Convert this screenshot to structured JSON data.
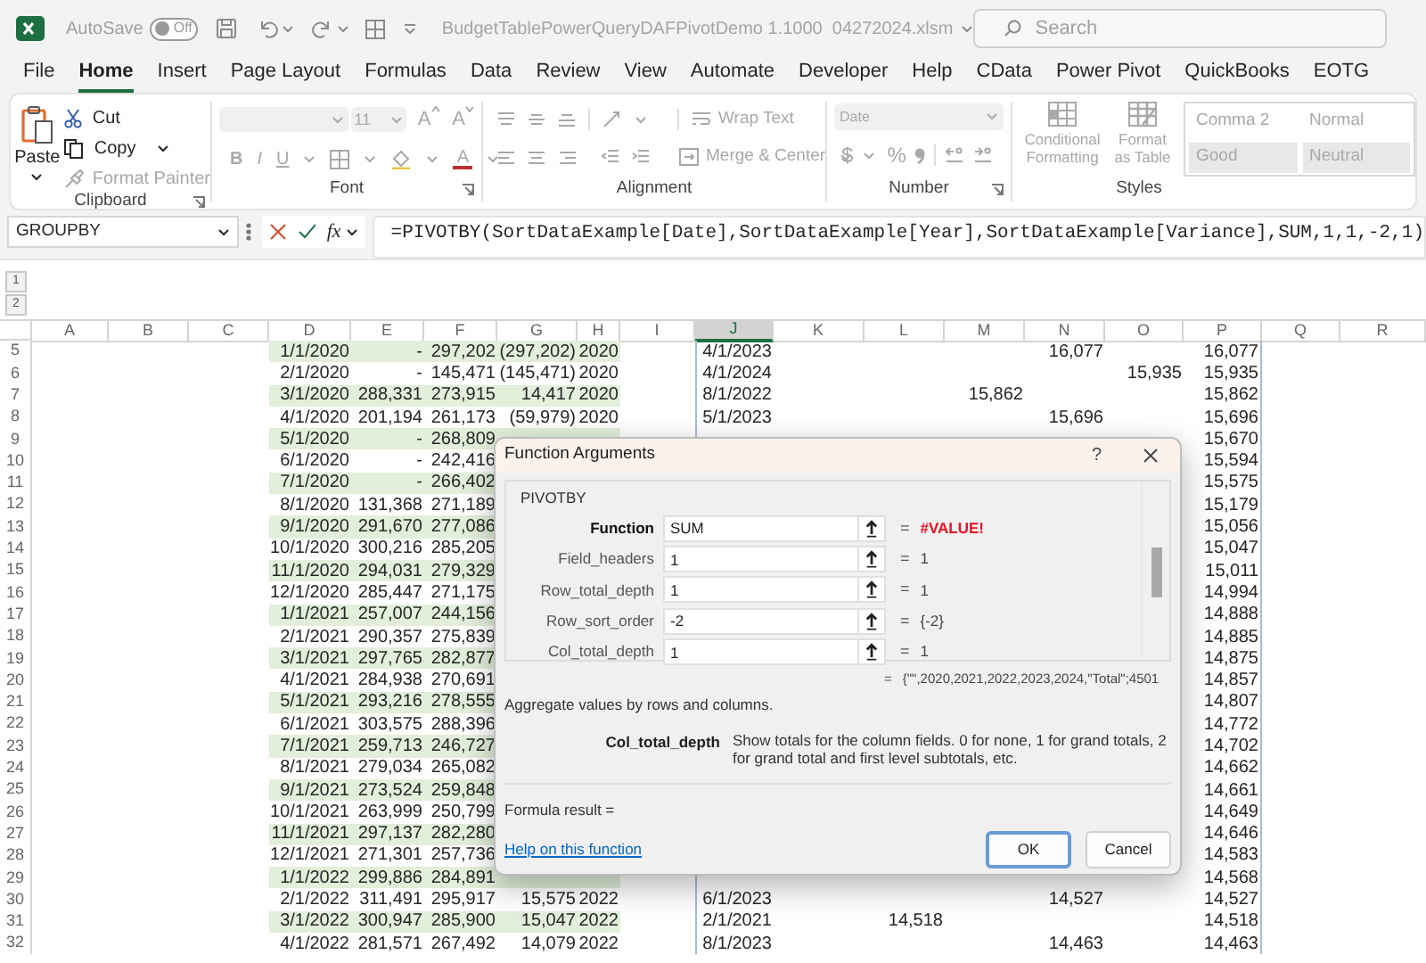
{
  "title_bar": {
    "autosave_label": "AutoSave",
    "autosave_toggle": {
      "label": "Off",
      "on": false
    },
    "file_name": "BudgetTablePowerQueryDAFPivotDemo 1.1000  04272024.xlsm",
    "search": {
      "placeholder": "Search"
    }
  },
  "menu_tabs": [
    {
      "label": "File",
      "selected": false
    },
    {
      "label": "Home",
      "selected": true
    },
    {
      "label": "Insert",
      "selected": false
    },
    {
      "label": "Page Layout",
      "selected": false
    },
    {
      "label": "Formulas",
      "selected": false
    },
    {
      "label": "Data",
      "selected": false
    },
    {
      "label": "Review",
      "selected": false
    },
    {
      "label": "View",
      "selected": false
    },
    {
      "label": "Automate",
      "selected": false
    },
    {
      "label": "Developer",
      "selected": false
    },
    {
      "label": "Help",
      "selected": false
    },
    {
      "label": "CData",
      "selected": false
    },
    {
      "label": "Power Pivot",
      "selected": false
    },
    {
      "label": "QuickBooks",
      "selected": false
    },
    {
      "label": "EOTG",
      "selected": false
    }
  ],
  "ribbon": {
    "clipboard": {
      "label": "Clipboard",
      "disabled": false,
      "paste": "Paste",
      "cut": "Cut",
      "copy": "Copy",
      "format_painter": {
        "label": "Format Painter",
        "disabled": true
      }
    },
    "font": {
      "label": "Font",
      "disabled": true,
      "size": "11",
      "grow_font": "A",
      "shrink_font": "A",
      "bold": "B",
      "italic": "I",
      "underline": "U",
      "font_color": "A"
    },
    "alignment": {
      "label": "Alignment",
      "disabled": true,
      "wrap_text": "Wrap Text",
      "merge_center": "Merge & Center"
    },
    "number": {
      "label": "Number",
      "disabled": true,
      "format": "Date",
      "currency": "$",
      "percent": "%"
    },
    "styles": {
      "label": "Styles",
      "disabled": true,
      "conditional_formatting": "Conditional Formatting",
      "format_as_table": "Format as Table",
      "cell_styles": [
        {
          "label": "Comma 2",
          "kind": "plain"
        },
        {
          "label": "Normal",
          "kind": "plain"
        },
        {
          "label": "Good",
          "kind": "shaded"
        },
        {
          "label": "Neutral",
          "kind": "shaded"
        }
      ]
    }
  },
  "formula_bar": {
    "name_box": "GROUPBY",
    "fx": "fx",
    "formula": "=PIVOTBY(SortDataExample[Date],SortDataExample[Year],SortDataExample[Variance],SUM,1,1,-2,1)"
  },
  "outline_levels": [
    "1",
    "2"
  ],
  "sheet": {
    "columns": [
      {
        "label": "A",
        "selected": false
      },
      {
        "label": "B",
        "selected": false
      },
      {
        "label": "C",
        "selected": false
      },
      {
        "label": "D",
        "selected": false
      },
      {
        "label": "E",
        "selected": false
      },
      {
        "label": "F",
        "selected": false
      },
      {
        "label": "G",
        "selected": false
      },
      {
        "label": "H",
        "selected": false
      },
      {
        "label": "I",
        "selected": false
      },
      {
        "label": "J",
        "selected": true
      },
      {
        "label": "K",
        "selected": false
      },
      {
        "label": "L",
        "selected": false
      },
      {
        "label": "M",
        "selected": false
      },
      {
        "label": "N",
        "selected": false
      },
      {
        "label": "O",
        "selected": false
      },
      {
        "label": "P",
        "selected": false
      },
      {
        "label": "Q",
        "selected": false
      },
      {
        "label": "R",
        "selected": false
      }
    ],
    "rows": [
      {
        "number": "5",
        "band": true,
        "cells": {
          "D": "1/1/2020",
          "E": "-",
          "F": "297,202",
          "G": "(297,202)",
          "H": "2020",
          "J": "4/1/2023",
          "N": "16,077",
          "P": "16,077"
        }
      },
      {
        "number": "6",
        "band": false,
        "cells": {
          "D": "2/1/2020",
          "E": "-",
          "F": "145,471",
          "G": "(145,471)",
          "H": "2020",
          "J": "4/1/2024",
          "O": "15,935",
          "P": "15,935"
        }
      },
      {
        "number": "7",
        "band": true,
        "cells": {
          "D": "3/1/2020",
          "E": "288,331",
          "F": "273,915",
          "G": "14,417",
          "H": "2020",
          "J": "8/1/2022",
          "M": "15,862",
          "P": "15,862"
        }
      },
      {
        "number": "8",
        "band": false,
        "cells": {
          "D": "4/1/2020",
          "E": "201,194",
          "F": "261,173",
          "G": "(59,979)",
          "H": "2020",
          "J": "5/1/2023",
          "N": "15,696",
          "P": "15,696"
        }
      },
      {
        "number": "9",
        "band": true,
        "cells": {
          "D": "5/1/2020",
          "E": "-",
          "F": "268,809",
          "P": "15,670"
        }
      },
      {
        "number": "10",
        "band": false,
        "cells": {
          "D": "6/1/2020",
          "E": "-",
          "F": "242,416",
          "P": "15,594"
        }
      },
      {
        "number": "11",
        "band": true,
        "cells": {
          "D": "7/1/2020",
          "E": "-",
          "F": "266,402",
          "P": "15,575"
        }
      },
      {
        "number": "12",
        "band": false,
        "cells": {
          "D": "8/1/2020",
          "E": "131,368",
          "F": "271,189",
          "P": "15,179"
        }
      },
      {
        "number": "13",
        "band": true,
        "cells": {
          "D": "9/1/2020",
          "E": "291,670",
          "F": "277,086",
          "P": "15,056"
        }
      },
      {
        "number": "14",
        "band": false,
        "cells": {
          "D": "10/1/2020",
          "E": "300,216",
          "F": "285,205",
          "P": "15,047"
        }
      },
      {
        "number": "15",
        "band": true,
        "cells": {
          "D": "11/1/2020",
          "E": "294,031",
          "F": "279,329",
          "P": "15,011"
        }
      },
      {
        "number": "16",
        "band": false,
        "cells": {
          "D": "12/1/2020",
          "E": "285,447",
          "F": "271,175",
          "P": "14,994"
        }
      },
      {
        "number": "17",
        "band": true,
        "cells": {
          "D": "1/1/2021",
          "E": "257,007",
          "F": "244,156",
          "P": "14,888"
        }
      },
      {
        "number": "18",
        "band": false,
        "cells": {
          "D": "2/1/2021",
          "E": "290,357",
          "F": "275,839",
          "P": "14,885"
        }
      },
      {
        "number": "19",
        "band": true,
        "cells": {
          "D": "3/1/2021",
          "E": "297,765",
          "F": "282,877",
          "P": "14,875"
        }
      },
      {
        "number": "20",
        "band": false,
        "cells": {
          "D": "4/1/2021",
          "E": "284,938",
          "F": "270,691",
          "P": "14,857"
        }
      },
      {
        "number": "21",
        "band": true,
        "cells": {
          "D": "5/1/2021",
          "E": "293,216",
          "F": "278,555",
          "P": "14,807"
        }
      },
      {
        "number": "22",
        "band": false,
        "cells": {
          "D": "6/1/2021",
          "E": "303,575",
          "F": "288,396",
          "P": "14,772"
        }
      },
      {
        "number": "23",
        "band": true,
        "cells": {
          "D": "7/1/2021",
          "E": "259,713",
          "F": "246,727",
          "P": "14,702"
        }
      },
      {
        "number": "24",
        "band": false,
        "cells": {
          "D": "8/1/2021",
          "E": "279,034",
          "F": "265,082",
          "P": "14,662"
        }
      },
      {
        "number": "25",
        "band": true,
        "cells": {
          "D": "9/1/2021",
          "E": "273,524",
          "F": "259,848",
          "P": "14,661"
        }
      },
      {
        "number": "26",
        "band": false,
        "cells": {
          "D": "10/1/2021",
          "E": "263,999",
          "F": "250,799",
          "P": "14,649"
        }
      },
      {
        "number": "27",
        "band": true,
        "cells": {
          "D": "11/1/2021",
          "E": "297,137",
          "F": "282,280",
          "P": "14,646"
        }
      },
      {
        "number": "28",
        "band": false,
        "cells": {
          "D": "12/1/2021",
          "E": "271,301",
          "F": "257,736",
          "P": "14,583"
        }
      },
      {
        "number": "29",
        "band": true,
        "cells": {
          "D": "1/1/2022",
          "E": "299,886",
          "F": "284,891",
          "P": "14,568"
        }
      },
      {
        "number": "30",
        "band": false,
        "cells": {
          "D": "2/1/2022",
          "E": "311,491",
          "F": "295,917",
          "G": "15,575",
          "H": "2022",
          "J": "6/1/2023",
          "N": "14,527",
          "P": "14,527"
        }
      },
      {
        "number": "31",
        "band": true,
        "cells": {
          "D": "3/1/2022",
          "E": "300,947",
          "F": "285,900",
          "G": "15,047",
          "H": "2022",
          "J": "2/1/2021",
          "L": "14,518",
          "P": "14,518"
        }
      },
      {
        "number": "32",
        "band": false,
        "cells": {
          "D": "4/1/2022",
          "E": "281,571",
          "F": "267,492",
          "G": "14,079",
          "H": "2022",
          "J": "8/1/2023",
          "N": "14,463",
          "P": "14,463"
        }
      }
    ]
  },
  "dialog": {
    "title": "Function Arguments",
    "help_button": "?",
    "function_name": "PIVOTBY",
    "arguments": [
      {
        "name": "Function",
        "required": true,
        "value": "SUM",
        "sign": "=",
        "result": "#VALUE!",
        "error": true
      },
      {
        "name": "Field_headers",
        "required": false,
        "value": "1",
        "sign": "=",
        "result": "1",
        "error": false
      },
      {
        "name": "Row_total_depth",
        "required": false,
        "value": "1",
        "sign": "=",
        "result": "1",
        "error": false
      },
      {
        "name": "Row_sort_order",
        "required": false,
        "value": "-2",
        "sign": "=",
        "result": "{-2}",
        "error": false
      },
      {
        "name": "Col_total_depth",
        "required": false,
        "value": "1",
        "sign": "=",
        "result": "1",
        "error": false
      }
    ],
    "overall_result": {
      "sign": "=",
      "value": "{\"\",2020,2021,2022,2023,2024,\"Total\";4501"
    },
    "description": "Aggregate values by rows and columns.",
    "argument_help": {
      "name": "Col_total_depth",
      "text": "Show totals for the column fields. 0 for none, 1 for grand totals, 2 for grand total and first level subtotals, etc."
    },
    "formula_result": "Formula result =",
    "help_link": "Help on this function",
    "buttons": [
      {
        "label": "OK",
        "default": true
      },
      {
        "label": "Cancel",
        "default": false
      }
    ]
  }
}
